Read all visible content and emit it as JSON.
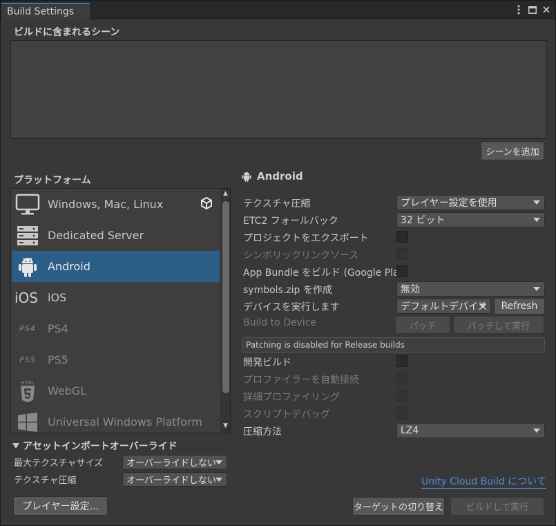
{
  "window": {
    "tab_title": "Build Settings",
    "menu_icon": "kebab-menu-icon",
    "maximize_icon": "maximize-icon",
    "close_icon": "close-icon"
  },
  "scenes": {
    "heading": "ビルドに含まれるシーン",
    "add_button": "シーンを追加"
  },
  "platforms": {
    "heading": "プラットフォーム",
    "items": [
      {
        "label": "Windows, Mac, Linux",
        "icon": "monitor-icon",
        "badge": "unity-logo-icon"
      },
      {
        "label": "Dedicated Server",
        "icon": "server-icon"
      },
      {
        "label": "Android",
        "icon": "android-icon",
        "selected": true
      },
      {
        "label": "iOS",
        "icon": "ios-icon",
        "icon_text": "iOS"
      },
      {
        "label": "PS4",
        "icon": "ps4-icon",
        "icon_text": "PS4"
      },
      {
        "label": "PS5",
        "icon": "ps5-icon",
        "icon_text": "PS5"
      },
      {
        "label": "WebGL",
        "icon": "html5-icon",
        "icon_text": "HTML"
      },
      {
        "label": "Universal Windows Platform",
        "icon": "windows-icon"
      }
    ]
  },
  "asset_override": {
    "heading": "アセットインポートオーバーライド",
    "max_texture_label": "最大テクスチャサイズ",
    "max_texture_value": "オーバーライドしない",
    "texture_compression_label": "テクスチャ圧縮",
    "texture_compression_value": "オーバーライドしない"
  },
  "player_settings_button": "プレイヤー設定...",
  "android": {
    "title": "Android",
    "texture_compression_label": "テクスチャ圧縮",
    "texture_compression_value": "プレイヤー設定を使用",
    "etc2_fallback_label": "ETC2 フォールバック",
    "etc2_fallback_value": "32 ビット",
    "export_project_label": "プロジェクトをエクスポート",
    "symlink_sources_label": "シンボリックリンクソース",
    "app_bundle_label": "App Bundle をビルド (Google Pla",
    "symbols_zip_label": "symbols.zip を作成",
    "symbols_zip_value": "無効",
    "run_device_label": "デバイスを実行します",
    "run_device_value": "デフォルトデバイス",
    "refresh_button": "Refresh",
    "build_to_device_label": "Build to Device",
    "patch_button": "パッチ",
    "patch_and_run_button": "パッチして実行",
    "patching_notice": "Patching is disabled for Release builds",
    "dev_build_label": "開発ビルド",
    "autoconnect_profiler_label": "プロファイラーを自動接続",
    "deep_profiling_label": "詳細プロファイリング",
    "script_debugging_label": "スクリプトデバッグ",
    "compression_label": "圧縮方法",
    "compression_value": "LZ4"
  },
  "cloud_build_link": "Unity Cloud Build について",
  "switch_target_button": "ターゲットの切り替え",
  "build_and_run_button": "ビルドして実行"
}
